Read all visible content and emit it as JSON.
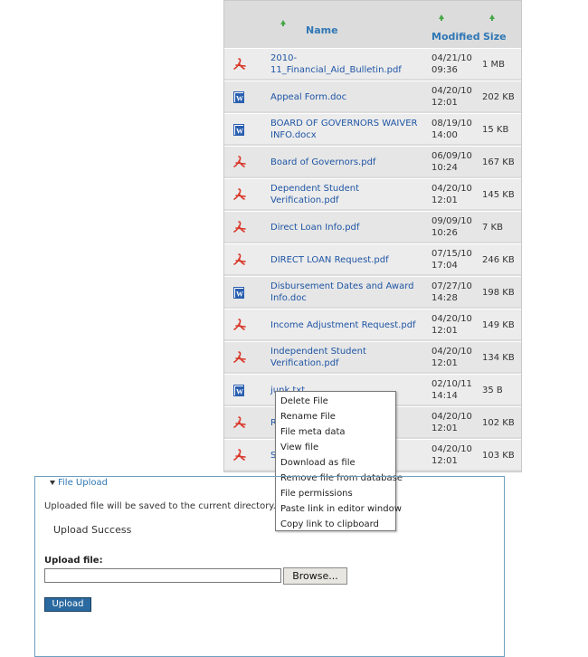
{
  "table": {
    "headers": {
      "name": "Name",
      "modified": "Modified",
      "size": "Size"
    },
    "rows": [
      {
        "name": "2010-11_Financial_Aid_Bulletin.pdf",
        "modified": "04/21/10\n09:36",
        "size": "1 MB",
        "type": "pdf"
      },
      {
        "name": "Appeal Form.doc",
        "modified": "04/20/10\n12:01",
        "size": "202 KB",
        "type": "doc"
      },
      {
        "name": "BOARD OF GOVERNORS WAIVER INFO.docx",
        "modified": "08/19/10\n14:00",
        "size": "15 KB",
        "type": "doc"
      },
      {
        "name": "Board of Governors.pdf",
        "modified": "06/09/10\n10:24",
        "size": "167 KB",
        "type": "pdf"
      },
      {
        "name": "Dependent Student Verification.pdf",
        "modified": "04/20/10\n12:01",
        "size": "145 KB",
        "type": "pdf"
      },
      {
        "name": "Direct Loan Info.pdf",
        "modified": "09/09/10\n10:26",
        "size": "7 KB",
        "type": "pdf"
      },
      {
        "name": "DIRECT LOAN Request.pdf",
        "modified": "07/15/10\n17:04",
        "size": "246 KB",
        "type": "pdf"
      },
      {
        "name": "Disbursement Dates and Award Info.doc",
        "modified": "07/27/10\n14:28",
        "size": "198 KB",
        "type": "doc"
      },
      {
        "name": "Income Adjustment Request.pdf",
        "modified": "04/20/10\n12:01",
        "size": "149 KB",
        "type": "pdf"
      },
      {
        "name": "Independent Student Verification.pdf",
        "modified": "04/20/10\n12:01",
        "size": "134 KB",
        "type": "pdf"
      },
      {
        "name": "junk.txt",
        "modified": "02/10/11\n14:14",
        "size": "35 B",
        "type": "doc"
      },
      {
        "name": "R...df",
        "modified": "04/20/10\n12:01",
        "size": "102 KB",
        "type": "pdf"
      },
      {
        "name": "S... C...",
        "modified": "04/20/10\n12:01",
        "size": "103 KB",
        "type": "pdf"
      }
    ]
  },
  "context_menu": {
    "items": [
      "Delete File",
      "Rename File",
      "File meta data",
      "View file",
      "Download as file",
      "Remove file from database",
      "File permissions",
      "Paste link in editor window",
      "Copy link to clipboard"
    ]
  },
  "upload": {
    "legend": "File Upload",
    "info": "Uploaded file will be saved to the current directory.",
    "status": "Upload Success",
    "file_label": "Upload file:",
    "browse_label": "Browse...",
    "upload_label": "Upload"
  },
  "colors": {
    "link": "#1f55a4",
    "header": "#2f77b5",
    "sort_arrow": "#46a646",
    "pdf_icon": "#d9382a",
    "doc_icon": "#2a5fb0"
  }
}
